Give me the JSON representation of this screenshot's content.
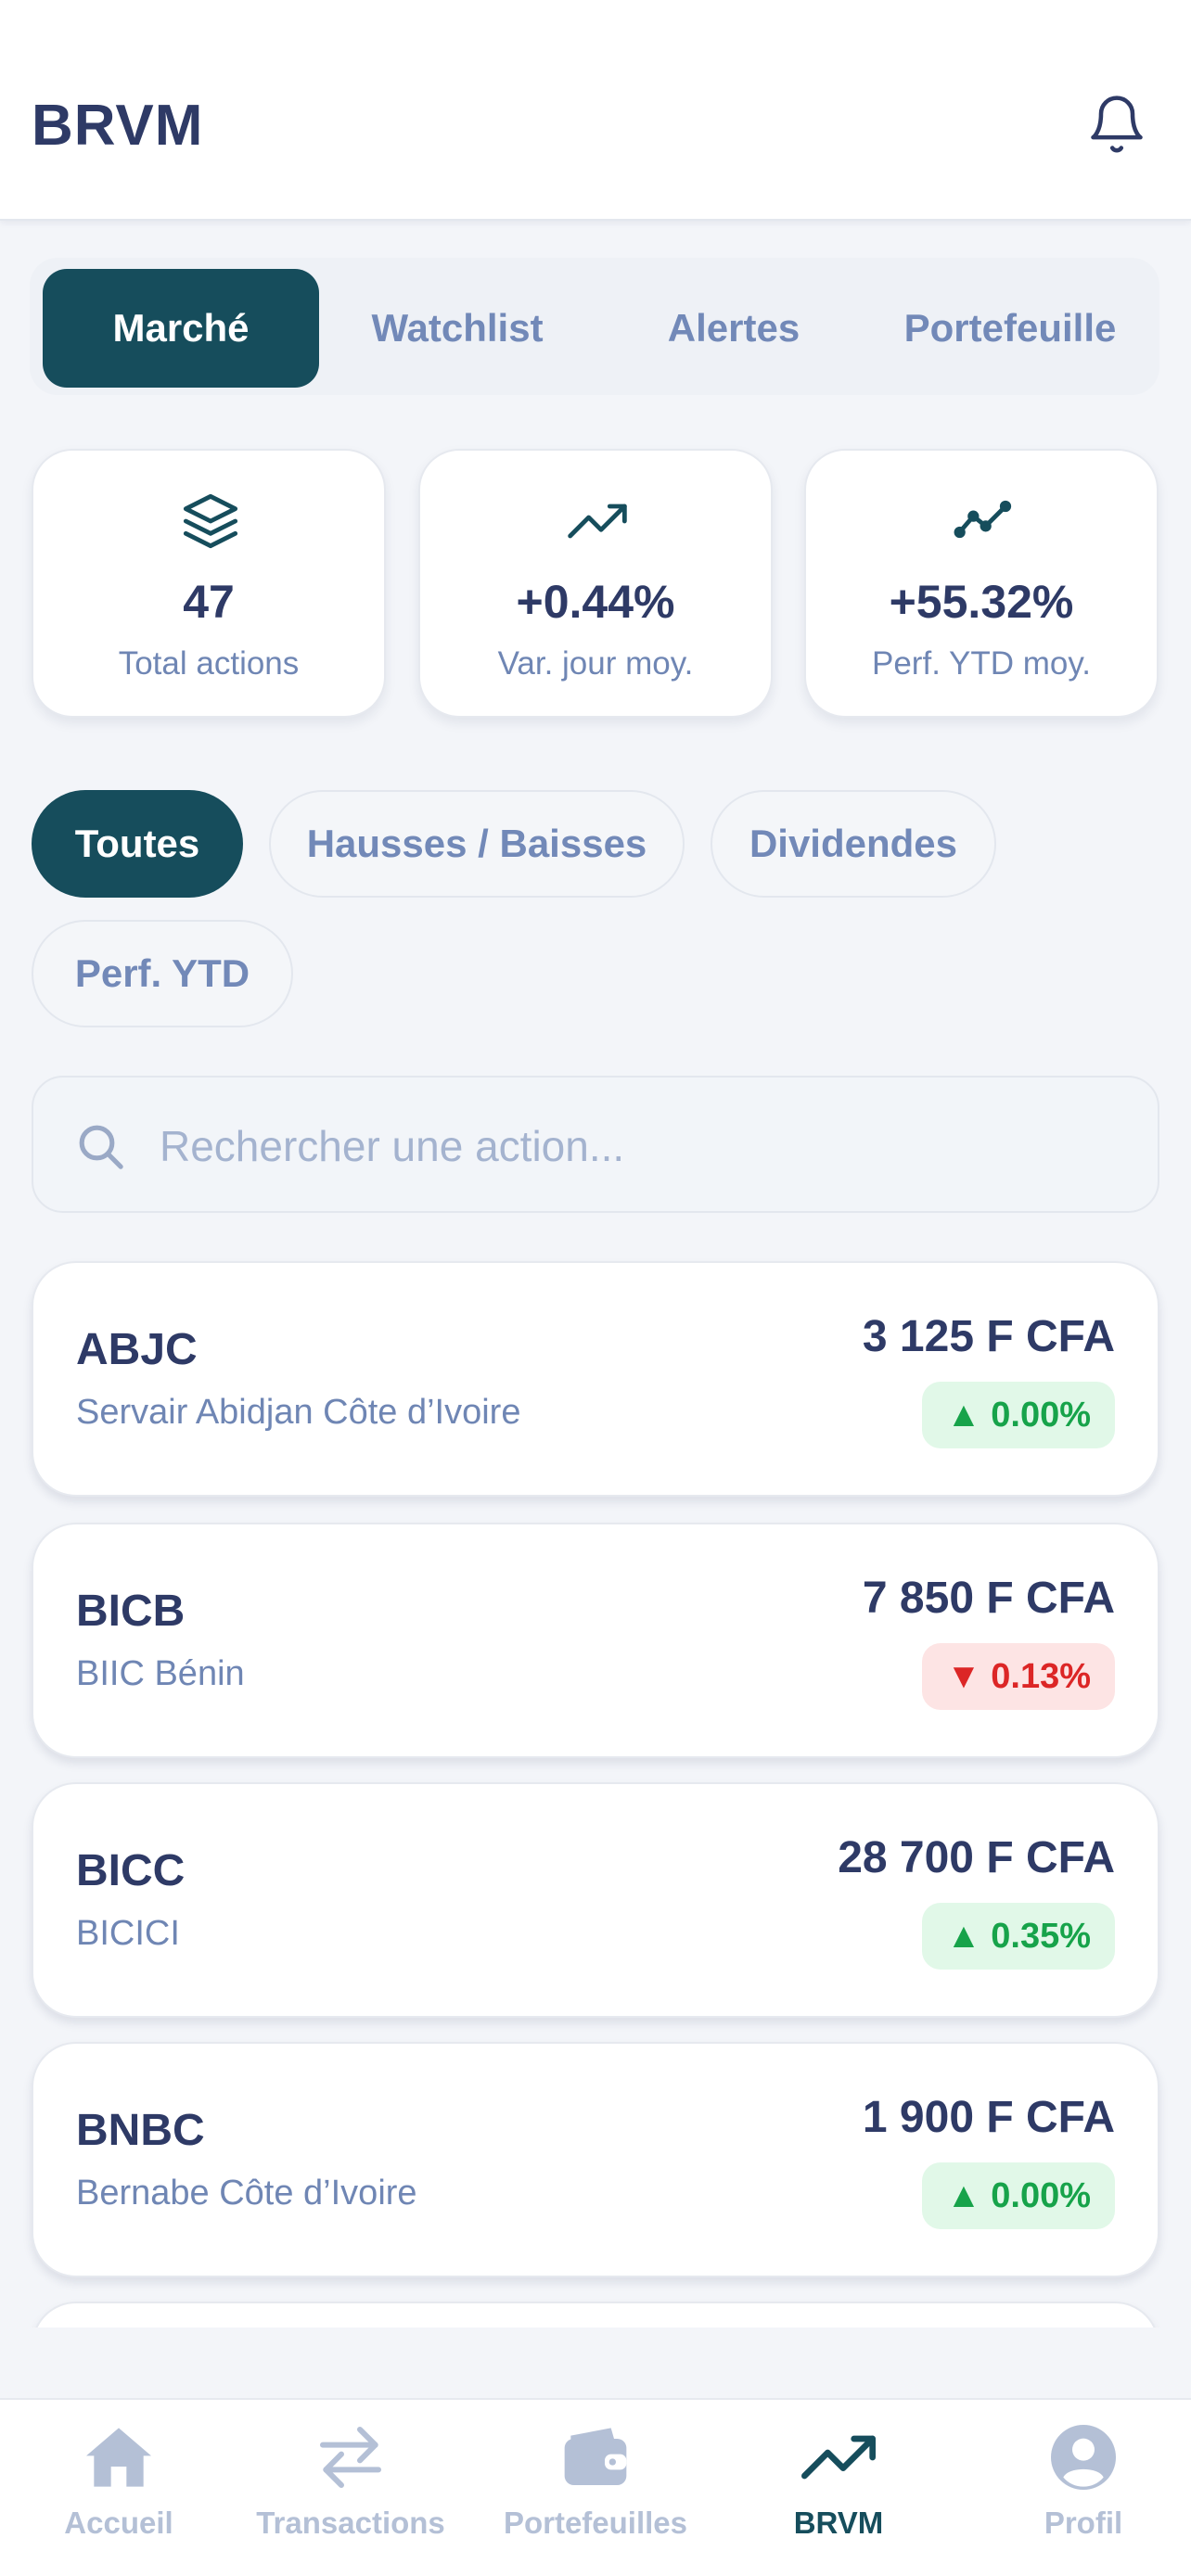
{
  "header": {
    "title": "BRVM"
  },
  "tabs": [
    "Marché",
    "Watchlist",
    "Alertes",
    "Portefeuille"
  ],
  "stats": [
    {
      "value": "47",
      "label": "Total actions",
      "icon": "layers-icon"
    },
    {
      "value": "+0.44%",
      "label": "Var. jour moy.",
      "icon": "trending-up-icon"
    },
    {
      "value": "+55.32%",
      "label": "Perf. YTD moy.",
      "icon": "line-chart-icon"
    }
  ],
  "filters": [
    "Toutes",
    "Hausses / Baisses",
    "Dividendes",
    "Perf. YTD"
  ],
  "search": {
    "placeholder": "Rechercher une action..."
  },
  "stocks": [
    {
      "symbol": "ABJC",
      "name": "Servair Abidjan Côte d’Ivoire",
      "price": "3 125 F CFA",
      "change": "▲ 0.00%",
      "direction": "up"
    },
    {
      "symbol": "BICB",
      "name": "BIIC Bénin",
      "price": "7 850 F CFA",
      "change": "▼ 0.13%",
      "direction": "down"
    },
    {
      "symbol": "BICC",
      "name": "BICICI",
      "price": "28 700 F CFA",
      "change": "▲ 0.35%",
      "direction": "up"
    },
    {
      "symbol": "BNBC",
      "name": "Bernabe Côte d’Ivoire",
      "price": "1 900 F CFA",
      "change": "▲ 0.00%",
      "direction": "up"
    }
  ],
  "bottom_nav": [
    {
      "label": "Accueil",
      "icon": "home-icon"
    },
    {
      "label": "Transactions",
      "icon": "swap-icon"
    },
    {
      "label": "Portefeuilles",
      "icon": "wallet-icon"
    },
    {
      "label": "BRVM",
      "icon": "trending-up-icon"
    },
    {
      "label": "Profil",
      "icon": "user-icon"
    }
  ],
  "colors": {
    "primary": "#164d5c",
    "text": "#2e3a66",
    "muted": "#6f86b4",
    "up": "#17a34a",
    "down": "#dc2626"
  }
}
